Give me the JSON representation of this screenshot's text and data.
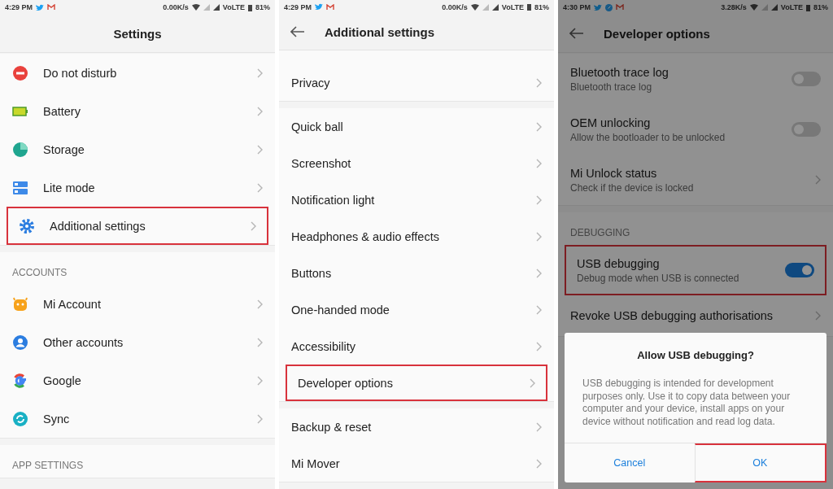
{
  "panels": [
    {
      "status_bar": {
        "time": "4:29 PM",
        "speed": "0.00K/s",
        "network": "VoLTE",
        "battery": "81%"
      },
      "title": "Settings",
      "back": false,
      "dimmed": false,
      "groups": [
        {
          "items": [
            {
              "label": "Do not disturb",
              "highlighted": false
            },
            {
              "label": "Battery",
              "highlighted": false
            },
            {
              "label": "Storage",
              "highlighted": false
            },
            {
              "label": "Lite mode",
              "highlighted": false
            },
            {
              "label": "Additional settings",
              "highlighted": true
            }
          ]
        },
        {
          "header": "ACCOUNTS",
          "items": [
            {
              "label": "Mi Account",
              "highlighted": false
            },
            {
              "label": "Other accounts",
              "highlighted": false
            },
            {
              "label": "Google",
              "highlighted": false
            },
            {
              "label": "Sync",
              "highlighted": false
            }
          ]
        },
        {
          "header": "APP SETTINGS"
        }
      ]
    },
    {
      "status_bar": {
        "time": "4:29 PM",
        "speed": "0.00K/s",
        "network": "VoLTE",
        "battery": "81%"
      },
      "title": "Additional settings",
      "back": true,
      "dimmed": false,
      "groups": [
        {
          "items": [
            {
              "label": "Privacy",
              "highlighted": false
            }
          ]
        },
        {
          "items": [
            {
              "label": "Quick ball",
              "highlighted": false
            },
            {
              "label": "Screenshot",
              "highlighted": false
            },
            {
              "label": "Notification light",
              "highlighted": false
            },
            {
              "label": "Headphones & audio effects",
              "highlighted": false
            },
            {
              "label": "Buttons",
              "highlighted": false
            },
            {
              "label": "One-handed mode",
              "highlighted": false
            },
            {
              "label": "Accessibility",
              "highlighted": false
            },
            {
              "label": "Developer options",
              "highlighted": true
            }
          ]
        },
        {
          "items": [
            {
              "label": "Backup & reset",
              "highlighted": false
            },
            {
              "label": "Mi Mover",
              "highlighted": false
            }
          ]
        }
      ]
    },
    {
      "status_bar": {
        "time": "4:30 PM",
        "speed": "3.28K/s",
        "network": "VoLTE",
        "battery": "81%"
      },
      "title": "Developer options",
      "back": true,
      "dimmed": true,
      "groups": [
        {
          "items": [
            {
              "kind": "toggle",
              "label": "Bluetooth trace log",
              "subtitle": "Bluetooth trace log",
              "on": false,
              "highlighted": false
            },
            {
              "kind": "toggle",
              "label": "OEM unlocking",
              "subtitle": "Allow the bootloader to be unlocked",
              "on": false,
              "highlighted": false
            },
            {
              "kind": "link",
              "label": "Mi Unlock status",
              "subtitle": "Check if the device is locked",
              "highlighted": false
            }
          ]
        },
        {
          "header": "DEBUGGING",
          "items": [
            {
              "kind": "toggle",
              "label": "USB debugging",
              "subtitle": "Debug mode when USB is connected",
              "on": true,
              "highlighted": true
            },
            {
              "kind": "link",
              "label": "Revoke USB debugging authorisations",
              "highlighted": false
            }
          ]
        }
      ],
      "dialog": {
        "title": "Allow USB debugging?",
        "message": "USB debugging is intended for development purposes only. Use it to copy data between your computer and your device, install apps on your device without notification and read log data.",
        "buttons": [
          {
            "label": "Cancel",
            "highlighted": false
          },
          {
            "label": "OK",
            "highlighted": true
          }
        ]
      }
    }
  ]
}
